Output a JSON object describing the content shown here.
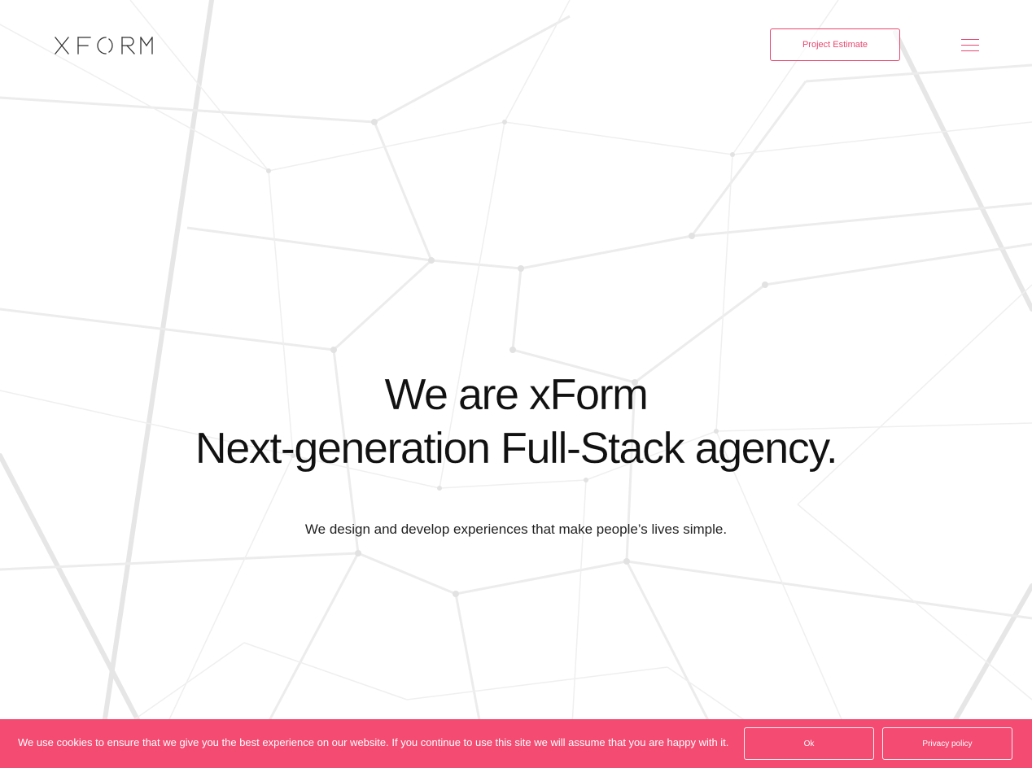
{
  "header": {
    "logo_text": "XFORM",
    "project_estimate_label": "Project Estimate",
    "menu_icon": "hamburger-menu-icon"
  },
  "hero": {
    "title_line1": "We are xForm",
    "title_line2": "Next-generation Full-Stack agency.",
    "subtitle": "We design and develop experiences that make people’s lives simple."
  },
  "cookie_banner": {
    "message": "We use cookies to ensure that we give you the best experience on our website. If you continue to use this site we will assume that you are happy with it.",
    "ok_label": "Ok",
    "privacy_label": "Privacy policy"
  },
  "colors": {
    "accent": "#e8466f",
    "banner_background": "#f34b72",
    "background": "#ffffff",
    "text": "#111111"
  }
}
